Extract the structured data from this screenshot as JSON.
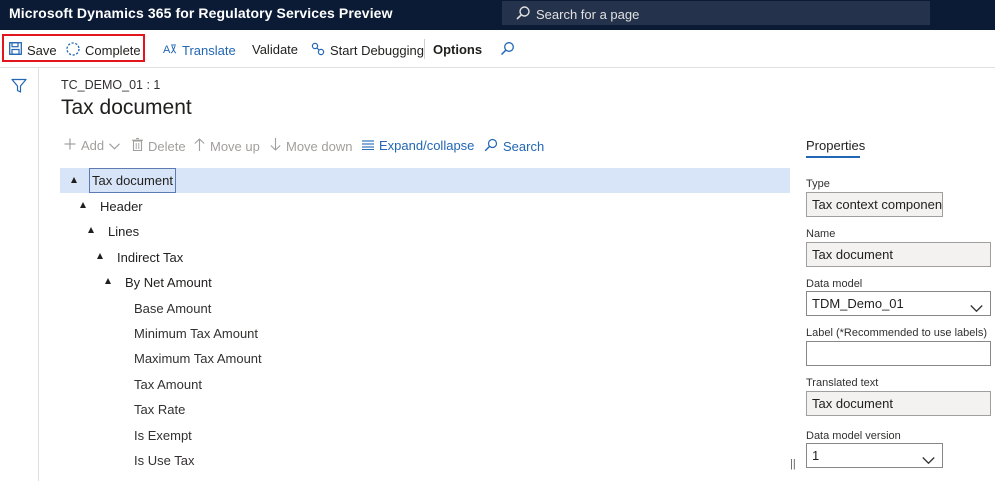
{
  "app": {
    "title": "Microsoft Dynamics 365 for Regulatory Services Preview",
    "search_placeholder": "Search for a page"
  },
  "actions": {
    "save": "Save",
    "complete": "Complete",
    "translate": "Translate",
    "validate": "Validate",
    "start_debugging": "Start Debugging",
    "options": "Options"
  },
  "page": {
    "breadcrumb": "TC_DEMO_01 : 1",
    "title": "Tax document"
  },
  "tree_toolbar": {
    "add": "Add",
    "delete": "Delete",
    "move_up": "Move up",
    "move_down": "Move down",
    "expand_collapse": "Expand/collapse",
    "search": "Search"
  },
  "tree": {
    "nodes": [
      {
        "label": "Tax document",
        "expanded": true,
        "selected": true
      },
      {
        "label": "Header",
        "expanded": true
      },
      {
        "label": "Lines",
        "expanded": true
      },
      {
        "label": "Indirect Tax",
        "expanded": true
      },
      {
        "label": "By Net Amount",
        "expanded": true
      },
      {
        "label": "Base Amount"
      },
      {
        "label": "Minimum Tax Amount"
      },
      {
        "label": "Maximum Tax Amount"
      },
      {
        "label": "Tax Amount"
      },
      {
        "label": "Tax Rate"
      },
      {
        "label": "Is Exempt"
      },
      {
        "label": "Is Use Tax"
      }
    ]
  },
  "properties": {
    "tab_label": "Properties",
    "type_label": "Type",
    "type_value": "Tax context component",
    "name_label": "Name",
    "name_value": "Tax document",
    "data_model_label": "Data model",
    "data_model_value": "TDM_Demo_01",
    "label_label": "Label (*Recommended to use labels)",
    "label_value": "",
    "translated_text_label": "Translated text",
    "translated_text_value": "Tax document",
    "data_model_version_label": "Data model version",
    "data_model_version_value": "1"
  },
  "colors": {
    "topbar": "#0b1b36",
    "accent": "#2266b4",
    "selection": "#d8e4f7",
    "highlight_border": "#e3141b"
  }
}
